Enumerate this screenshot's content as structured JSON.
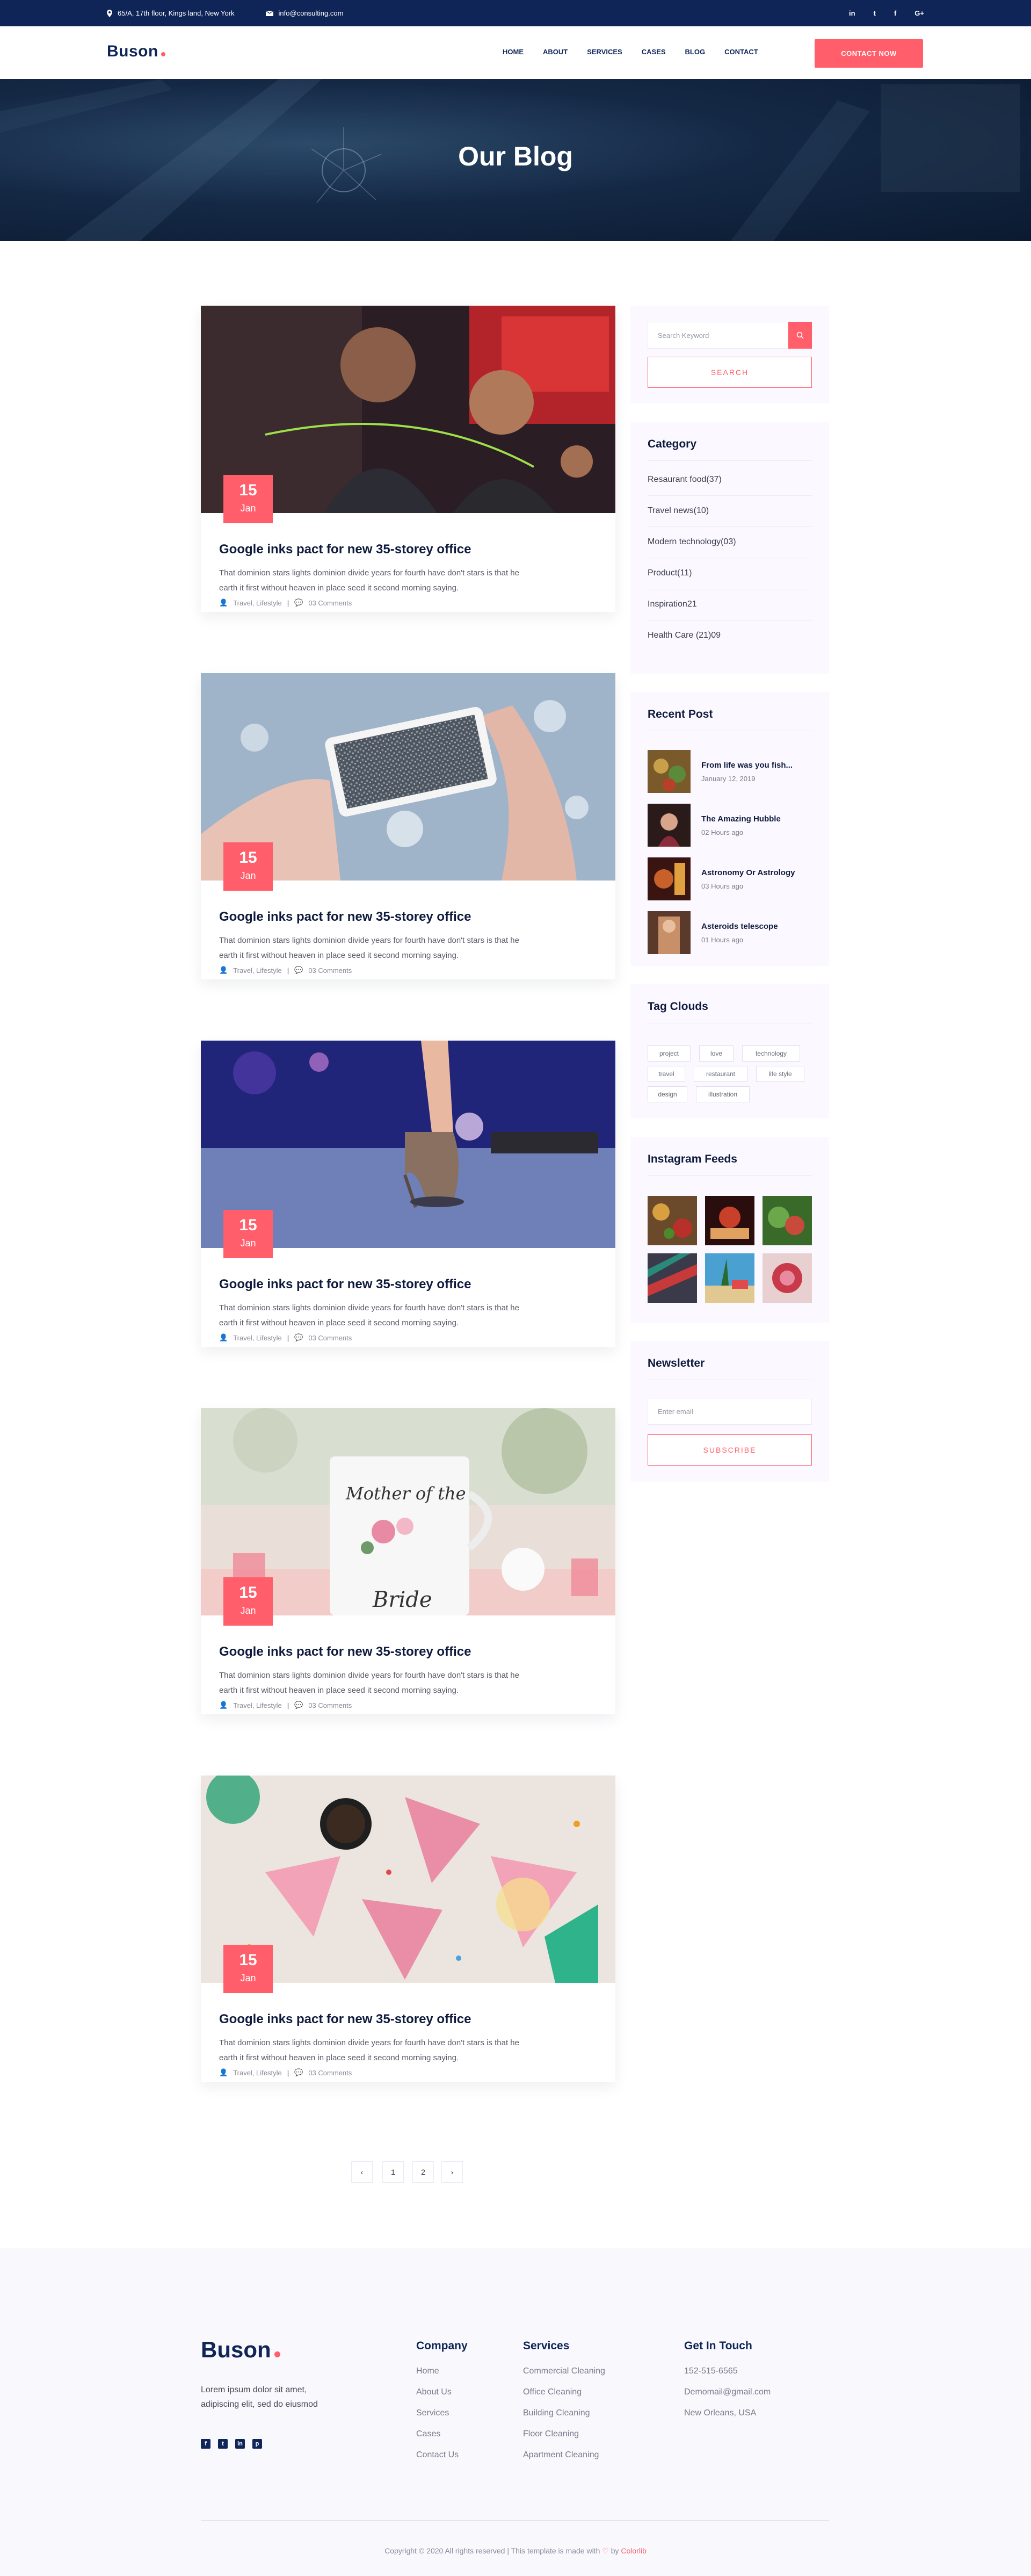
{
  "topbar": {
    "address": "65/A, 17th floor, Kings land, New York",
    "email": "info@consulting.com",
    "social": [
      "in",
      "t",
      "f",
      "G+"
    ]
  },
  "header": {
    "logo": "Buson",
    "nav": [
      "HOME",
      "ABOUT",
      "SERVICES",
      "CASES",
      "BLOG",
      "CONTACT"
    ],
    "cta": "CONTACT NOW"
  },
  "hero": {
    "title": "Our Blog"
  },
  "posts": [
    {
      "day": "15",
      "month": "Jan",
      "title": "Google inks pact for new 35-storey office",
      "excerpt_line1": "That dominion stars lights dominion divide years for fourth have don't stars is that he",
      "excerpt_line2": "earth it first without heaven in place seed it second morning saying.",
      "category": "Travel, Lifestyle",
      "comments": "03 Comments"
    },
    {
      "day": "15",
      "month": "Jan",
      "title": "Google inks pact for new 35-storey office",
      "excerpt_line1": "That dominion stars lights dominion divide years for fourth have don't stars is that he",
      "excerpt_line2": "earth it first without heaven in place seed it second morning saying.",
      "category": "Travel, Lifestyle",
      "comments": "03 Comments"
    },
    {
      "day": "15",
      "month": "Jan",
      "title": "Google inks pact for new 35-storey office",
      "excerpt_line1": "That dominion stars lights dominion divide years for fourth have don't stars is that he",
      "excerpt_line2": "earth it first without heaven in place seed it second morning saying.",
      "category": "Travel, Lifestyle",
      "comments": "03 Comments"
    },
    {
      "day": "15",
      "month": "Jan",
      "title": "Google inks pact for new 35-storey office",
      "excerpt_line1": "That dominion stars lights dominion divide years for fourth have don't stars is that he",
      "excerpt_line2": "earth it first without heaven in place seed it second morning saying.",
      "category": "Travel, Lifestyle",
      "comments": "03 Comments"
    },
    {
      "day": "15",
      "month": "Jan",
      "title": "Google inks pact for new 35-storey office",
      "excerpt_line1": "That dominion stars lights dominion divide years for fourth have don't stars is that he",
      "excerpt_line2": "earth it first without heaven in place seed it second morning saying.",
      "category": "Travel, Lifestyle",
      "comments": "03 Comments"
    }
  ],
  "sidebar": {
    "search": {
      "placeholder": "Search Keyword",
      "button": "SEARCH"
    },
    "category": {
      "title": "Category",
      "items": [
        "Resaurant food(37)",
        "Travel news(10)",
        "Modern technology(03)",
        "Product(11)",
        "Inspiration21",
        "Health Care (21)09"
      ]
    },
    "recent": {
      "title": "Recent Post",
      "items": [
        {
          "title": "From life was you fish...",
          "time": "January 12, 2019"
        },
        {
          "title": "The Amazing Hubble",
          "time": "02 Hours ago"
        },
        {
          "title": "Astronomy Or Astrology",
          "time": "03 Hours ago"
        },
        {
          "title": "Asteroids telescope",
          "time": "01 Hours ago"
        }
      ]
    },
    "tags": {
      "title": "Tag Clouds",
      "items": [
        "project",
        "love",
        "technology",
        "travel",
        "restaurant",
        "life style",
        "design",
        "illustration"
      ]
    },
    "instagram": {
      "title": "Instagram Feeds"
    },
    "newsletter": {
      "title": "Newsletter",
      "placeholder": "Enter email",
      "button": "SUBSCRIBE"
    }
  },
  "pagination": {
    "prev": "‹",
    "pages": [
      "1",
      "2"
    ],
    "next": "›"
  },
  "footer": {
    "logo": "Buson",
    "about_line1": "Lorem ipsum dolor sit amet,",
    "about_line2": "adipiscing elit, sed do eiusmod",
    "social": [
      "f",
      "t",
      "in",
      "p"
    ],
    "company": {
      "title": "Company",
      "links": [
        "Home",
        "About Us",
        "Services",
        "Cases",
        "Contact Us"
      ]
    },
    "services": {
      "title": "Services",
      "links": [
        "Commercial Cleaning",
        "Office Cleaning",
        "Building Cleaning",
        "Floor Cleaning",
        "Apartment Cleaning"
      ]
    },
    "contact": {
      "title": "Get In Touch",
      "lines": [
        "152-515-6565",
        "Demomail@gmail.com",
        "New Orleans, USA"
      ]
    },
    "copyright_pre": "Copyright © 2020 All rights reserved | This template is made with",
    "copyright_heart": "♡",
    "copyright_by": "by",
    "copyright_brand": "Colorlib"
  },
  "colors": {
    "navy": "#0f2558",
    "accent": "#ff5e6a",
    "panel": "#fbf9ff"
  }
}
